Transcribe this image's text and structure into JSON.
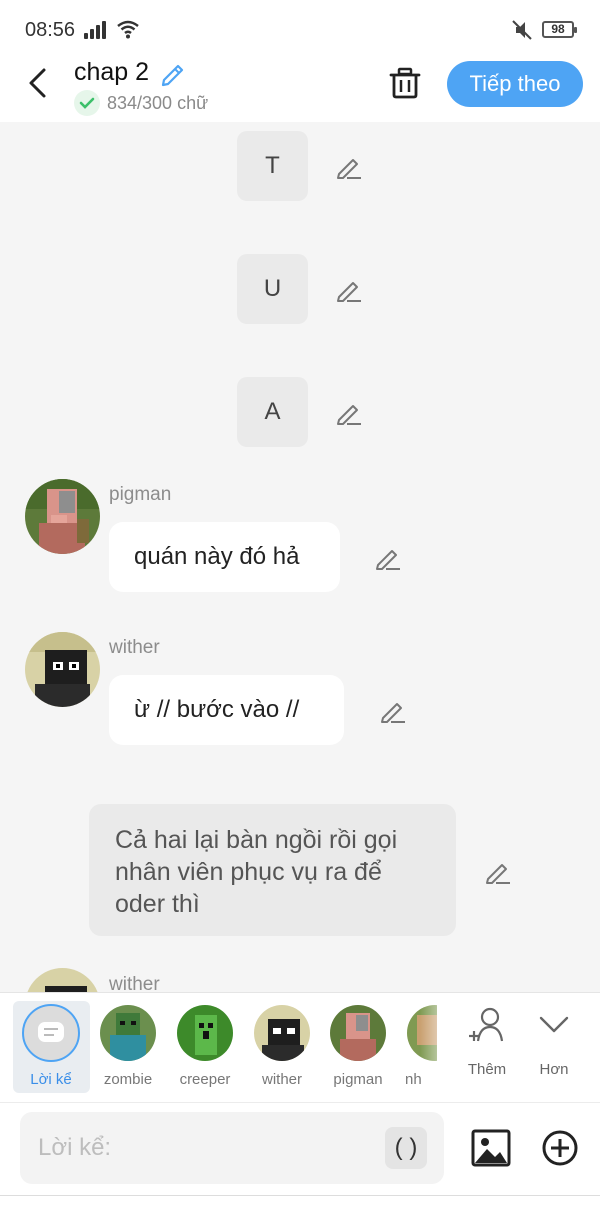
{
  "status": {
    "time": "08:56",
    "battery": "98"
  },
  "header": {
    "title": "chap 2",
    "word_count": "834/300 chữ",
    "next_label": "Tiếp theo"
  },
  "chat": {
    "letters": [
      "T",
      "U",
      "A"
    ],
    "messages": [
      {
        "speaker": "pigman",
        "text": "quán này đó hả"
      },
      {
        "speaker": "wither",
        "text": "ừ // bước vào //"
      }
    ],
    "narration": "Cả hai lại bàn ngồi rồi gọi nhân viên phục vụ ra để oder thì",
    "next_speaker": "wither"
  },
  "characters": [
    "Lời kể",
    "zombie",
    "creeper",
    "wither",
    "pigman",
    "nh"
  ],
  "actions": {
    "add_label": "Thêm",
    "more_label": "Hơn"
  },
  "input": {
    "placeholder": "Lời kể:",
    "paren_label": "( )"
  },
  "colors": {
    "accent": "#4ea4f4",
    "check": "#3cc06a"
  }
}
